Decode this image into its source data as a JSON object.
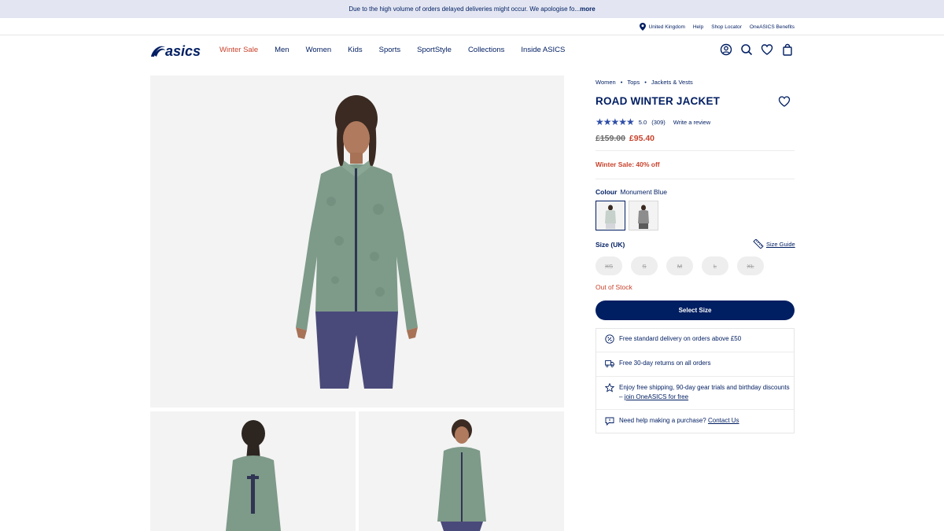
{
  "announcement": {
    "text": "Due to the high volume of orders delayed deliveries might occur. We apologise fo...",
    "more": "more"
  },
  "utility": {
    "location": "United Kingdom",
    "help": "Help",
    "shop_locator": "Shop Locator",
    "benefits": "OneASICS Benefits"
  },
  "brand": {
    "logo_text": "asics",
    "primary_color": "#001e62",
    "sale_color": "#c8422c"
  },
  "nav": {
    "items": [
      "Winter Sale",
      "Men",
      "Women",
      "Kids",
      "Sports",
      "SportStyle",
      "Collections",
      "Inside ASICS"
    ]
  },
  "header_icons": [
    "account-icon",
    "search-icon",
    "wishlist-icon",
    "bag-icon"
  ],
  "product": {
    "breadcrumb": [
      "Women",
      "Tops",
      "Jackets & Vests"
    ],
    "title": "ROAD WINTER JACKET",
    "stars": "★★★★★",
    "rating": "5.0",
    "review_count": "(309)",
    "write_review": "Write a review",
    "old_price": "£159.00",
    "new_price": "£95.40",
    "promo": "Winter Sale: 40% off",
    "colour_label": "Colour",
    "colour_value": "Monument Blue",
    "size_label": "Size (UK)",
    "size_guide": "Size Guide",
    "sizes": [
      "XS",
      "S",
      "M",
      "L",
      "XL"
    ],
    "stock_status": "Out of Stock",
    "select_button": "Select Size"
  },
  "benefits": {
    "delivery": "Free standard delivery on orders above £50",
    "returns": "Free 30-day returns on all orders",
    "join_text": "Enjoy free shipping, 90-day gear trials and birthday discounts –",
    "join_link": "join OneASICS for free",
    "help_text": "Need help making a purchase?",
    "contact_link": "Contact Us"
  }
}
